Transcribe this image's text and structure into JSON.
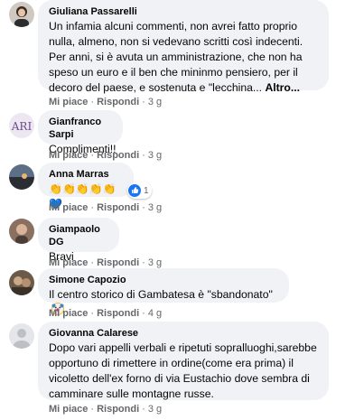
{
  "comments": [
    {
      "author": "Giuliana Passarelli",
      "text": "Un infamia alcuni commenti, non avrei fatto proprio nulla, almeno, non si vedevano scritti così indecenti. Per anni, si è avuta un amministrazione, che non ha speso un euro e il ben che mininmo pensiero, per il decoro del paese, e sostenuta e \"lecchina...",
      "more": "Altro...",
      "like": "Mi piace",
      "reply": "Rispondi",
      "time": "3 g"
    },
    {
      "author": "Gianfranco Sarpi",
      "text": "Complimenti!!",
      "like": "Mi piace",
      "reply": "Rispondi",
      "time": "3 g"
    },
    {
      "author": "Anna Marras",
      "text": "👏👏👏👏👏💙",
      "reaction_count": "1",
      "like": "Mi piace",
      "reply": "Rispondi",
      "time": "3 g"
    },
    {
      "author": "Giampaolo DG",
      "text": "Bravi",
      "like": "Mi piace",
      "reply": "Rispondi",
      "time": "3 g"
    },
    {
      "author": "Simone Capozio",
      "text": "Il centro storico di Gambatesa è \"sbandonato\"",
      "like": "Mi piace",
      "reply": "Rispondi",
      "time": "4 g"
    },
    {
      "author": "Giovanna Calarese",
      "text": "Dopo vari appelli verbali e ripetuti sopralluoghi,sarebbe opportuno di rimettere in ordine(come era prima) il vicoletto dell'ex forno di via Eustachio dove sembra di camminare sulle montagne russe.",
      "like": "Mi piace",
      "reply": "Rispondi",
      "time": "3 g"
    }
  ],
  "separator": "·",
  "colors": {
    "bubble": "#f0f2f5",
    "meta": "#65676b",
    "like_blue": "#1877f2",
    "heart_red": "#f33e58"
  }
}
